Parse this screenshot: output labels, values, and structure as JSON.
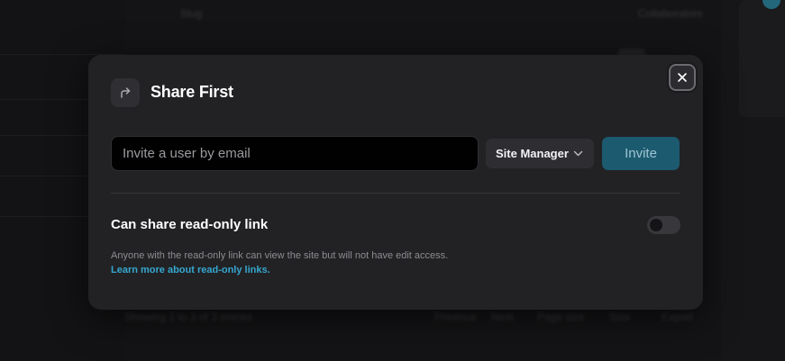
{
  "background": {
    "top_left_text": "Slug",
    "top_right_text": "Collaborators",
    "footer_left_text": "Showing 1 to 3 of 3 entries",
    "footer_buttons": [
      "Previous",
      "Next",
      "Page size",
      "Size",
      "Export"
    ]
  },
  "dialog": {
    "title": "Share First",
    "header_icon": "share-forward-icon",
    "close_icon": "close-icon",
    "email_placeholder": "Invite a user by email",
    "email_value": "",
    "role_selected": "Site Manager",
    "invite_label": "Invite",
    "readonly_heading": "Can share read-only link",
    "readonly_enabled": false,
    "readonly_description": "Anyone with the read-only link can view the site but will not have edit access.",
    "readonly_link_text": "Learn more about read-only links."
  },
  "colors": {
    "accent": "#1c5a6f",
    "link": "#35a7cf",
    "dialog_bg": "#222225",
    "input_bg": "#010101"
  }
}
